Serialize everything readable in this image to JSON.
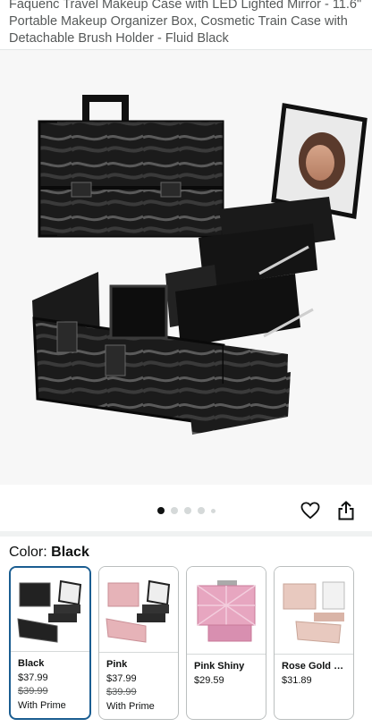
{
  "product": {
    "title": "Faquenc Travel Makeup Case with LED Lighted Mirror - 11.6\" Portable Makeup Organizer Box, Cosmetic Train Case with Detachable Brush Holder - Fluid Black"
  },
  "gallery": {
    "image_icon": "marble-train-case-photo",
    "dot_count": 5,
    "active_index": 0
  },
  "actions": {
    "wishlist_icon": "heart-icon",
    "share_icon": "share-icon"
  },
  "color": {
    "label": "Color:",
    "selected": "Black"
  },
  "variants": [
    {
      "name": "Black",
      "price": "$37.99",
      "list_price": "$39.99",
      "badge": "With Prime",
      "selected": true,
      "case_color": "#222222",
      "accent": "#555555"
    },
    {
      "name": "Pink",
      "price": "$37.99",
      "list_price": "$39.99",
      "badge": "With Prime",
      "selected": false,
      "case_color": "#e6b3b8",
      "accent": "#c98f96"
    },
    {
      "name": "Pink Shiny",
      "price": "$29.59",
      "list_price": "",
      "badge": "",
      "selected": false,
      "case_color": "#e7a6c0",
      "accent": "#c97a99"
    },
    {
      "name": "Rose Gold S...",
      "price": "$31.89",
      "list_price": "",
      "badge": "",
      "selected": false,
      "case_color": "#e8c9bf",
      "accent": "#c9a598"
    }
  ],
  "colors": {
    "selected_border": "#1a5d91",
    "text": "#0f1111",
    "muted": "#565959"
  }
}
